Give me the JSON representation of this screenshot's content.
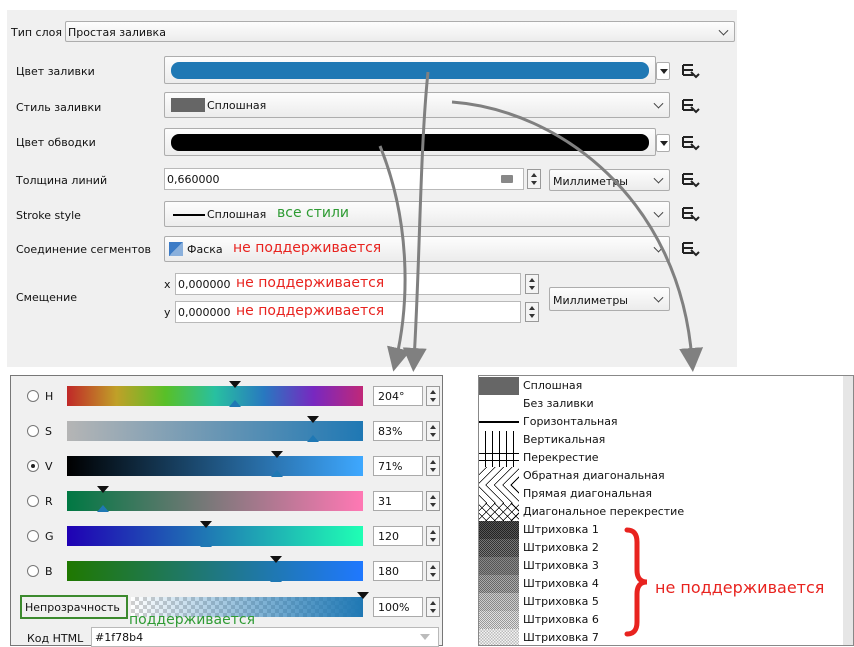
{
  "layer_type": {
    "label": "Тип слоя",
    "value": "Простая заливка"
  },
  "fill_color": {
    "label": "Цвет заливки",
    "color": "#1f78b4"
  },
  "fill_style": {
    "label": "Стиль заливки",
    "value": "Сплошная"
  },
  "stroke_color": {
    "label": "Цвет обводки",
    "color": "#000000"
  },
  "stroke_width": {
    "label": "Толщина линий",
    "value": "0,660000",
    "unit": "Миллиметры"
  },
  "stroke_style": {
    "label": "Stroke style",
    "value": "Сплошная",
    "note": "все стили"
  },
  "join_style": {
    "label": "Соединение сегментов",
    "value": "Фаска",
    "note": "не поддерживается"
  },
  "offset": {
    "label": "Смещение",
    "x_label": "x",
    "x_value": "0,000000",
    "x_note": "не поддерживается",
    "y_label": "y",
    "y_value": "0,000000",
    "y_note": "не поддерживается",
    "unit": "Миллиметры"
  },
  "color_picker": {
    "channels": [
      {
        "label": "H",
        "value": "204°",
        "level": 0.567,
        "selected": false
      },
      {
        "label": "S",
        "value": "83%",
        "level": 0.83,
        "selected": false
      },
      {
        "label": "V",
        "value": "71%",
        "level": 0.71,
        "selected": true
      },
      {
        "label": "R",
        "value": "31",
        "level": 0.122,
        "selected": false
      },
      {
        "label": "G",
        "value": "120",
        "level": 0.471,
        "selected": false
      },
      {
        "label": "B",
        "value": "180",
        "level": 0.706,
        "selected": false
      }
    ],
    "opacity": {
      "label": "Непрозрачность",
      "value": "100%",
      "level": 1.0,
      "note": "поддерживается"
    },
    "html_code": {
      "label": "Код HTML",
      "value": "#1f78b4"
    }
  },
  "fill_styles_list": {
    "items": [
      "Сплошная",
      "Без заливки",
      "Горизонтальная",
      "Вертикальная",
      "Перекрестие",
      "Обратная диагональная",
      "Прямая диагональная",
      "Диагональное перекрестие",
      "Штриховка 1",
      "Штриховка 2",
      "Штриховка 3",
      "Штриховка 4",
      "Штриховка 5",
      "Штриховка 6",
      "Штриховка 7"
    ],
    "note": "не поддерживается"
  },
  "colors": {
    "accent": "#1f78b4",
    "note_red": "#e8231f",
    "note_green": "#2e9b33",
    "arrow": "#808080"
  }
}
